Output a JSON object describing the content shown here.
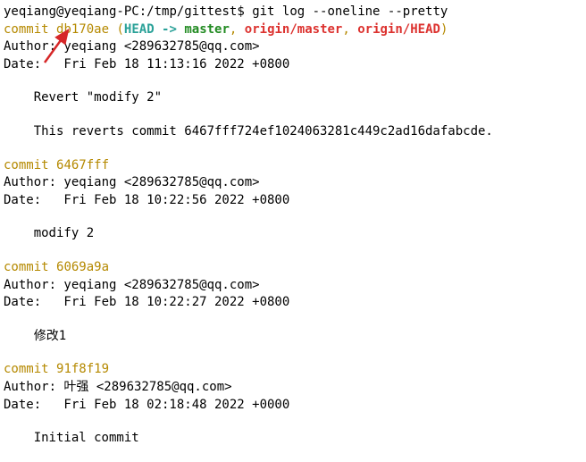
{
  "prompt": {
    "user_host": "yeqiang@yeqiang-PC",
    "cwd": "/tmp/gittest",
    "symbol": "$",
    "command": "git log --oneline --pretty"
  },
  "commits": [
    {
      "hash": "db170ae",
      "refs": {
        "open": "(",
        "head": "HEAD -> ",
        "branch": "master",
        "sep1": ", ",
        "remote1": "origin/master",
        "sep2": ", ",
        "remote2": "origin/HEAD",
        "close": ")"
      },
      "author": "Author: yeqiang <289632785@qq.com>",
      "date": "Date:   Fri Feb 18 11:13:16 2022 +0800",
      "messages": [
        "Revert \"modify 2\"",
        "",
        "This reverts commit 6467fff724ef1024063281c449c2ad16dafabcde."
      ]
    },
    {
      "hash": "6467fff",
      "author": "Author: yeqiang <289632785@qq.com>",
      "date": "Date:   Fri Feb 18 10:22:56 2022 +0800",
      "messages": [
        "modify 2"
      ]
    },
    {
      "hash": "6069a9a",
      "author": "Author: yeqiang <289632785@qq.com>",
      "date": "Date:   Fri Feb 18 10:22:27 2022 +0800",
      "messages": [
        "修改1"
      ]
    },
    {
      "hash": "91f8f19",
      "author": "Author: 叶强 <289632785@qq.com>",
      "date": "Date:   Fri Feb 18 02:18:48 2022 +0000",
      "messages": [
        "Initial commit"
      ]
    }
  ],
  "commit_prefix": "commit ",
  "annotation": {
    "arrow_color": "#d62728"
  }
}
